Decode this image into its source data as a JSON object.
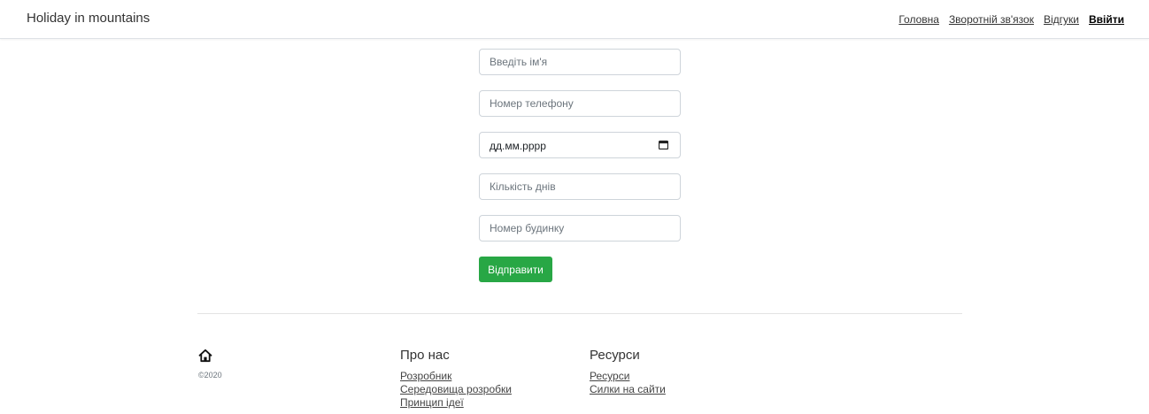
{
  "navbar": {
    "brand": "Holiday in mountains",
    "links": [
      "Головна",
      "Зворотній зв'язок",
      "Відгуки"
    ],
    "login": "Ввійти"
  },
  "form": {
    "name_placeholder": "Введіть ім'я",
    "phone_placeholder": "Номер телефону",
    "date_value": "дд.мм.рррр",
    "days_placeholder": "Кількість днів",
    "house_placeholder": "Номер будинку",
    "submit_label": "Відправити"
  },
  "footer": {
    "home_icon": "home-icon",
    "copyright": "©2020",
    "about": {
      "title": "Про нас",
      "links": [
        "Розробник",
        "Середовища розробки",
        "Принцип ідеї"
      ]
    },
    "resources": {
      "title": "Ресурси",
      "links": [
        "Ресурси",
        "Силки на сайти"
      ]
    }
  },
  "colors": {
    "accent": "#28a745",
    "border": "#ced4da"
  }
}
